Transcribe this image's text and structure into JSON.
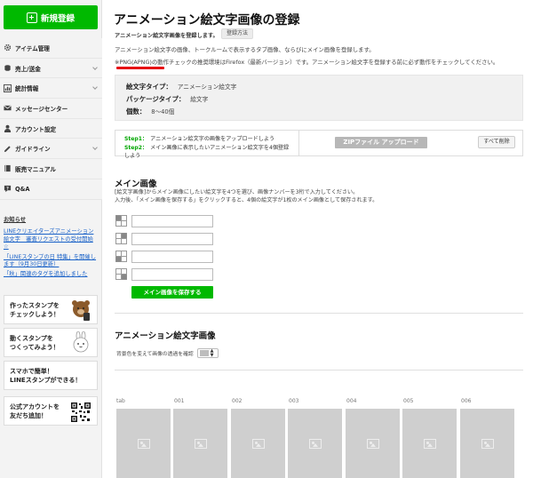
{
  "sidebar": {
    "new_button": "新規登録",
    "menu": [
      {
        "label": "アイテム管理",
        "icon": "gear-icon",
        "expandable": false
      },
      {
        "label": "売上/送金",
        "icon": "coins-icon",
        "expandable": true
      },
      {
        "label": "統計情報",
        "icon": "chart-icon",
        "expandable": true
      },
      {
        "label": "メッセージセンター",
        "icon": "mail-icon",
        "expandable": false
      },
      {
        "label": "アカウント設定",
        "icon": "user-icon",
        "expandable": false
      },
      {
        "label": "ガイドライン",
        "icon": "pen-icon",
        "expandable": true
      },
      {
        "label": "販売マニュアル",
        "icon": "book-icon",
        "expandable": false
      },
      {
        "label": "Q&A",
        "icon": "question-icon",
        "expandable": false
      }
    ],
    "notice_title": "お知らせ",
    "notices": [
      "LINEクリエイターズアニメーション絵文字　審査リクエストの受付開始☆",
      "「LINEスタンプの日 特集」を開催します（9月30日更新）",
      "「秋」関連のタグを追加しました"
    ],
    "banners": [
      {
        "line1": "作ったスタンプを",
        "line2": "チェックしよう！"
      },
      {
        "line1": "動くスタンプを",
        "line2": "つくってみよう！"
      },
      {
        "line1": "スマホで簡単！",
        "line2": "LINEスタンプができる！"
      },
      {
        "line1": "公式アカウントを",
        "line2": "友だち追加！"
      }
    ]
  },
  "main": {
    "title": "アニメーション絵文字画像の登録",
    "subtitle": "アニメーション絵文字画像を登録します。",
    "howto_button": "登録方法",
    "desc": "アニメーション絵文字の画像、トークルームで表示するタブ画像、ならびにメイン画像を登録します。",
    "warn": "※PNG(APNG)の動作チェックの推奨環境はFirefox（最新バージョン）です。アニメーション絵文字を登録する前に必ず動作をチェックしてください。",
    "info": [
      {
        "k": "絵文字タイプ：",
        "v": "アニメーション絵文字"
      },
      {
        "k": "パッケージタイプ：",
        "v": "絵文字"
      },
      {
        "k": "個数：",
        "v": "8〜40個"
      }
    ],
    "steps": [
      {
        "label": "Step1：",
        "text": "アニメーション絵文字の画像をアップロードしよう"
      },
      {
        "label": "Step2：",
        "text": "メイン画像に表示したいアニメーション絵文字を4個登録しよう"
      }
    ],
    "zip_button": "ZIPファイル アップロード",
    "clear_button": "すべて削除",
    "main_image_title": "メイン画像",
    "main_image_desc1": "[絵文字画像]からメイン画像にしたい絵文字を4つを選び、画像ナンバーを3桁で入力してください。",
    "main_image_desc2": "入力後、「メイン画像を保存する」をクリックすると、4個の絵文字が1枚のメイン画像として保存されます。",
    "save_button": "メイン画像を保存する",
    "anim_title": "アニメーション絵文字画像",
    "bg_label": "背景色を変えて画像の透過を確認",
    "thumb_labels": [
      "tab",
      "001",
      "002",
      "003",
      "004",
      "005",
      "006"
    ]
  },
  "colors": {
    "accent": "#00b900",
    "link": "#1a62c8",
    "warning_underline": "#e60012"
  }
}
